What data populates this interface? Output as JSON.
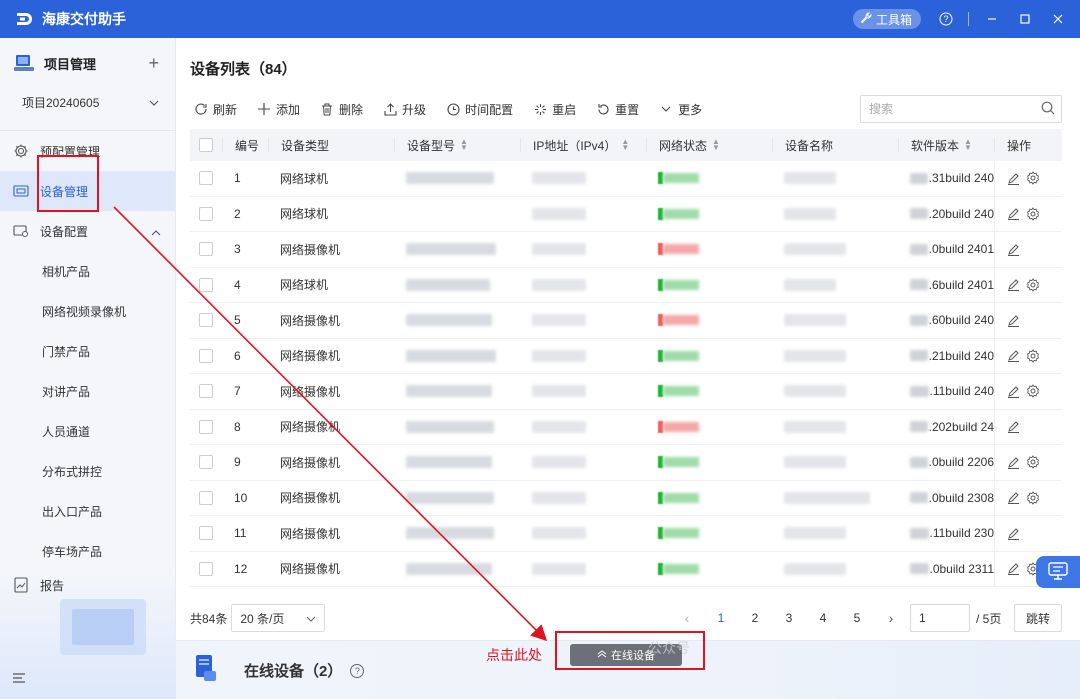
{
  "app": {
    "title": "海康交付助手",
    "toolbox_label": "工具箱"
  },
  "sidebar": {
    "project_header": "项目管理",
    "project_select": "项目20240605",
    "items": [
      {
        "label": "预配置管理",
        "icon": "gear-icon"
      },
      {
        "label": "设备管理",
        "icon": "device-icon"
      },
      {
        "label": "设备配置",
        "icon": "device-config-icon"
      }
    ],
    "sub_items": [
      "相机产品",
      "网络视频录像机",
      "门禁产品",
      "对讲产品",
      "人员通道",
      "分布式拼控",
      "出入口产品",
      "停车场产品"
    ],
    "report": "报告"
  },
  "main": {
    "title": "设备列表（84）",
    "toolbar": {
      "refresh": "刷新",
      "add": "添加",
      "delete": "删除",
      "upgrade": "升级",
      "time_config": "时间配置",
      "restart": "重启",
      "reset": "重置",
      "more": "更多"
    },
    "search_placeholder": "搜索",
    "columns": [
      "编号",
      "设备类型",
      "设备型号",
      "IP地址（IPv4）",
      "网络状态",
      "设备名称",
      "软件版本",
      "操作"
    ],
    "rows": [
      {
        "no": "1",
        "type": "网络球机",
        "status": "ok",
        "version": ".31build 240",
        "settings": true
      },
      {
        "no": "2",
        "type": "网络球机",
        "status": "ok",
        "version": ".20build 240",
        "settings": true
      },
      {
        "no": "3",
        "type": "网络摄像机",
        "status": "err",
        "version": ".0build 2401",
        "settings": false
      },
      {
        "no": "4",
        "type": "网络球机",
        "status": "ok",
        "version": ".6build 2401",
        "settings": true
      },
      {
        "no": "5",
        "type": "网络摄像机",
        "status": "err",
        "version": ".60build 240",
        "settings": false
      },
      {
        "no": "6",
        "type": "网络摄像机",
        "status": "ok",
        "version": ".21build 240",
        "settings": true
      },
      {
        "no": "7",
        "type": "网络摄像机",
        "status": "ok",
        "version": ".11build 240",
        "settings": true
      },
      {
        "no": "8",
        "type": "网络摄像机",
        "status": "err",
        "version": ".202build 24",
        "settings": false
      },
      {
        "no": "9",
        "type": "网络摄像机",
        "status": "ok",
        "version": ".0build 2206",
        "settings": true
      },
      {
        "no": "10",
        "type": "网络摄像机",
        "status": "ok",
        "version": ".0build 2308",
        "settings": true
      },
      {
        "no": "11",
        "type": "网络摄像机",
        "status": "ok",
        "version": ".11build 230",
        "settings": false
      },
      {
        "no": "12",
        "type": "网络摄像机",
        "status": "ok",
        "version": ".0build 2311",
        "settings": true
      }
    ],
    "pager": {
      "total": "共84条",
      "page_size": "20 条/页",
      "pages": [
        "1",
        "2",
        "3",
        "4",
        "5"
      ],
      "current": "1",
      "jump_value": "1",
      "total_pages": "/ 5页",
      "jump_label": "跳转"
    }
  },
  "bottom": {
    "title": "在线设备（2）",
    "online_btn": "在线设备"
  },
  "annotation": {
    "text": "点击此处",
    "color": "#e0141e"
  },
  "watermark": "公众号",
  "colors": {
    "primary": "#2b62d9",
    "status_ok": "#17b530",
    "status_err": "#ef5b5b"
  }
}
